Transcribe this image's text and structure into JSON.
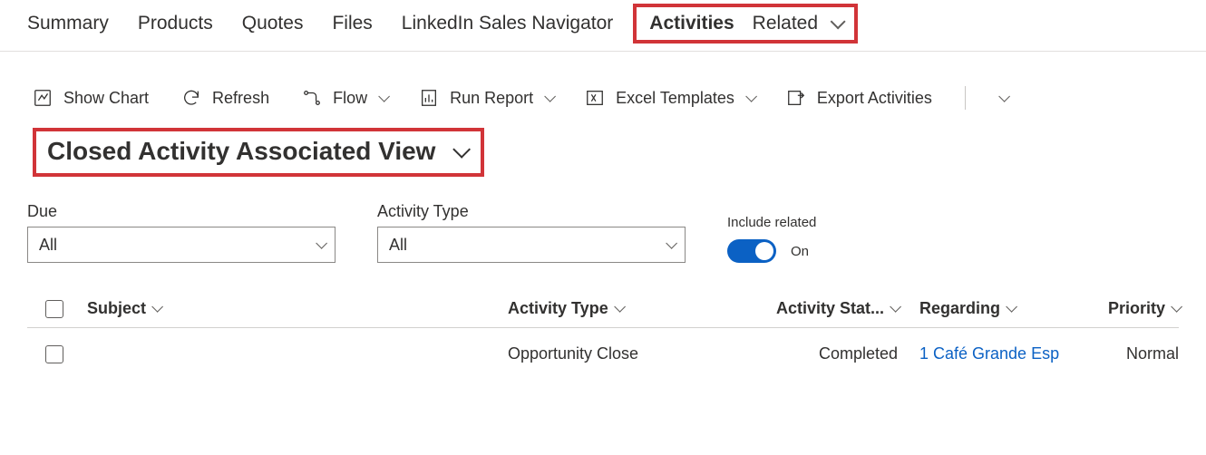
{
  "tabs": {
    "summary": "Summary",
    "products": "Products",
    "quotes": "Quotes",
    "files": "Files",
    "linkedin": "LinkedIn Sales Navigator",
    "activities": "Activities",
    "related": "Related"
  },
  "commands": {
    "show_chart": "Show Chart",
    "refresh": "Refresh",
    "flow": "Flow",
    "run_report": "Run Report",
    "excel_templates": "Excel Templates",
    "export_activities": "Export Activities"
  },
  "view": {
    "title": "Closed Activity Associated View"
  },
  "filters": {
    "due_label": "Due",
    "due_value": "All",
    "activity_type_label": "Activity Type",
    "activity_type_value": "All",
    "include_related_label": "Include related",
    "include_related_value": "On"
  },
  "columns": {
    "subject": "Subject",
    "activity_type": "Activity Type",
    "activity_status": "Activity Stat...",
    "regarding": "Regarding",
    "priority": "Priority"
  },
  "rows": [
    {
      "subject": "",
      "activity_type": "Opportunity Close",
      "activity_status": "Completed",
      "regarding": "1 Café Grande Esp",
      "priority": "Normal"
    }
  ]
}
